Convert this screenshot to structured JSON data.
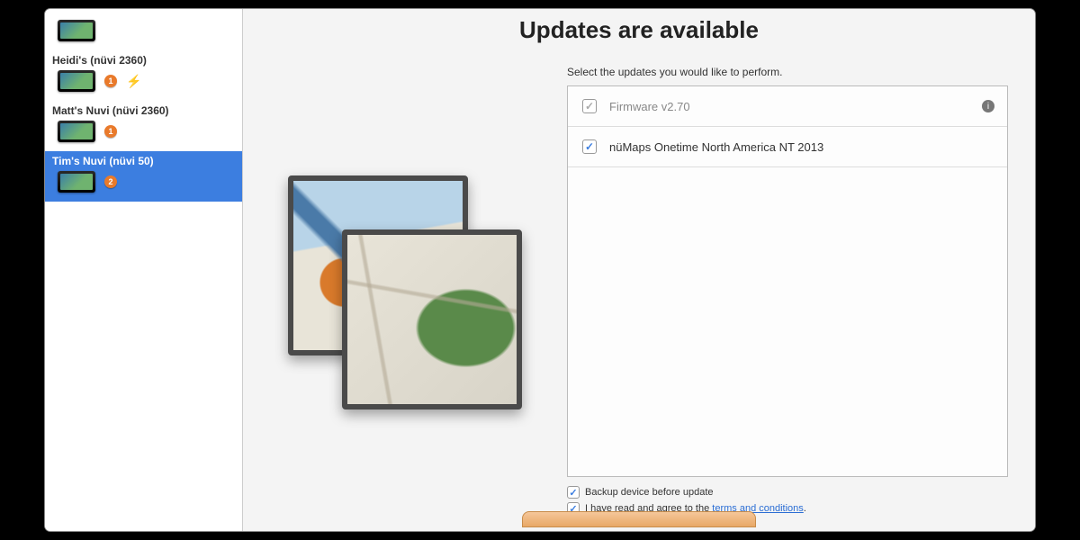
{
  "sidebar": {
    "devices": [
      {
        "label": "",
        "has_badge": false,
        "has_plug": false,
        "selected": false
      },
      {
        "label": "Heidi's (nüvi 2360)",
        "has_badge": true,
        "badge_count": "1",
        "has_plug": true,
        "selected": false
      },
      {
        "label": "Matt's Nuvi (nüvi 2360)",
        "has_badge": true,
        "badge_count": "1",
        "has_plug": false,
        "selected": false
      },
      {
        "label": "Tim's Nuvi (nüvi 50)",
        "has_badge": true,
        "badge_count": "2",
        "has_plug": false,
        "selected": true
      }
    ]
  },
  "main": {
    "title": "Updates are available",
    "instruction": "Select the updates you would like to perform.",
    "updates": [
      {
        "label": "Firmware v2.70",
        "checked": true,
        "disabled": true,
        "has_info": true
      },
      {
        "label": "nüMaps Onetime North America NT 2013",
        "checked": true,
        "disabled": false,
        "has_info": false
      }
    ],
    "footer": {
      "backup_label": "Backup device before update",
      "backup_checked": true,
      "terms_prefix": "I have read and agree to the ",
      "terms_link": "terms and conditions",
      "terms_suffix": ".",
      "terms_checked": true
    }
  }
}
